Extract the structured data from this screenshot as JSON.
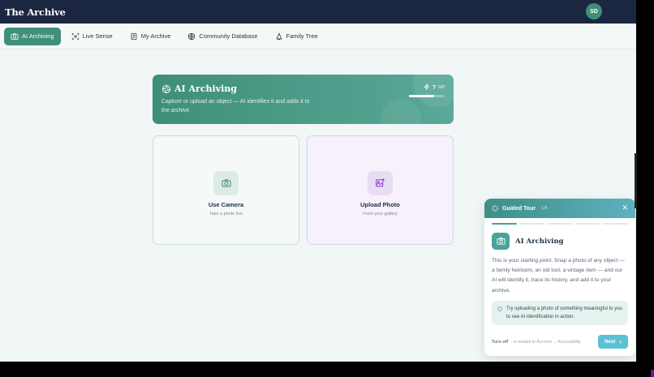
{
  "app": {
    "logo": "The Archive",
    "avatar_initials": "SD"
  },
  "nav": {
    "items": [
      {
        "label": "AI Archiving",
        "icon": "camera-icon",
        "active": true
      },
      {
        "label": "Live Sense",
        "icon": "scan-icon",
        "active": false
      },
      {
        "label": "My Archive",
        "icon": "archive-icon",
        "active": false
      },
      {
        "label": "Community Database",
        "icon": "globe-icon",
        "active": false
      },
      {
        "label": "Family Tree",
        "icon": "bell-tree-icon",
        "active": false
      }
    ]
  },
  "hero": {
    "title": "AI Archiving",
    "description": "Capture or upload an object — AI identifies it and adds it to the archive",
    "credits_count": "7",
    "credits_label": "left",
    "credits_fraction": 0.7
  },
  "cards": {
    "camera": {
      "title": "Use Camera",
      "subtitle": "Take a photo live"
    },
    "upload": {
      "title": "Upload Photo",
      "subtitle": "From your gallery"
    }
  },
  "tour": {
    "title": "Guided Tour",
    "step_text": "1/5",
    "total_steps": 5,
    "current_step": 1,
    "feature_title": "AI Archiving",
    "body": "This is your starting point. Snap a photo of any object — a family heirloom, an old tool, a vintage item — and our AI will identify it, trace its history, and add it to your archive.",
    "tip": "Try uploading a photo of something meaningful to you to see AI identification in action.",
    "turn_off_label": "Turn off",
    "turn_off_note": "· re-enable in Account → Accessibility",
    "next_label": "Next"
  },
  "colors": {
    "topbar": "#1b2740",
    "accent": "#3f8f7c",
    "next_button": "#5cc0d3"
  }
}
